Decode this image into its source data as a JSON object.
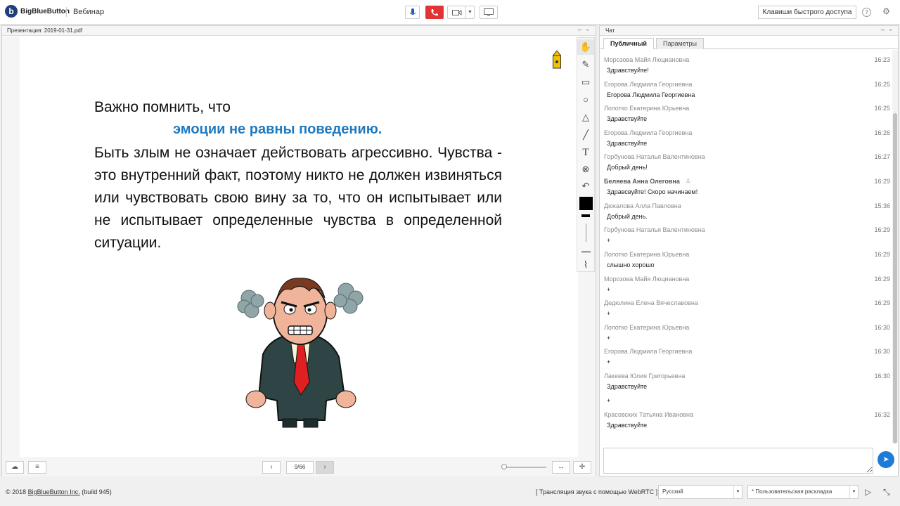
{
  "app": {
    "brand": "BigBlueButton",
    "logo_letter": "b",
    "meeting_name": "Вебинар",
    "hotkeys_label": "Клавиши быстрого доступа",
    "help_glyph": "?",
    "settings_glyph": "⚙"
  },
  "presentation": {
    "title": "Презентация: 2019-01-31.pdf",
    "slide": {
      "line1": "Важно помнить, что",
      "emphasis": "эмоции не равны поведению.",
      "paragraph": "Быть злым не означает действовать агрессивно. Чувства - это внутренний факт, поэтому никто не должен извиняться или чувствовать свою вину за то, что он испытывает или не испытывает определенные чувства в определенной ситуации."
    },
    "page_indicator": "9/66"
  },
  "chat": {
    "title": "Чат",
    "tabs": [
      "Публичный",
      "Параметры"
    ],
    "messages": [
      {
        "name": "Морозова Майя Люциановна",
        "time": "16:23",
        "text": "Здравствуйте!"
      },
      {
        "name": "Егорова Людмила Георгиевна",
        "time": "16:25",
        "text": "Егорова Людмила Георгиевна"
      },
      {
        "name": "Лопотко Екатерина Юрьевна",
        "time": "16:25",
        "text": "Здравствуйте"
      },
      {
        "name": "Егорова Людмила Георгиевна",
        "time": "16:26",
        "text": "Здравствуйте"
      },
      {
        "name": "Горбунова Наталья Валентиновна",
        "time": "16:27",
        "text": "Добрый день!"
      },
      {
        "name": "Беляева Анна Олеговна",
        "time": "16:29",
        "text": "Здравсвуйте! Скоро начинаем!"
      },
      {
        "name": "Дюкалова Алла Павловна",
        "time": "15:36",
        "text": "Добрый день."
      },
      {
        "name": "Горбунова Наталья Валентиновна",
        "time": "16:29",
        "text": "+"
      },
      {
        "name": "Лопотко Екатерина Юрьевна",
        "time": "16:29",
        "text": "слышно хорошо"
      },
      {
        "name": "Морозова Майя Люциановна",
        "time": "16:29",
        "text": "+"
      },
      {
        "name": "Дедюлина Елена Вячеславовна",
        "time": "16:29",
        "text": "+"
      },
      {
        "name": "Лопотко Екатерина Юрьевна",
        "time": "16:30",
        "text": "+"
      },
      {
        "name": "Егорова Людмила Георгиевна",
        "time": "16:30",
        "text": "+"
      },
      {
        "name": "Лакеева Юлия Григорьевна",
        "time": "16:30",
        "text": "Здравствуйте",
        "text2": "+"
      },
      {
        "name": "Красовских Татьяна Ивановна",
        "time": "16:32",
        "text": "Здравствуйте"
      }
    ]
  },
  "footer": {
    "copyright_prefix": "© 2018 ",
    "copyright_link": "BigBlueButton Inc.",
    "copyright_suffix": " (build 945)",
    "webrtc": "[ Трансляция звука с помощью WebRTC ]",
    "language": "Русский",
    "layout": "* Пользовательская раскладка"
  }
}
